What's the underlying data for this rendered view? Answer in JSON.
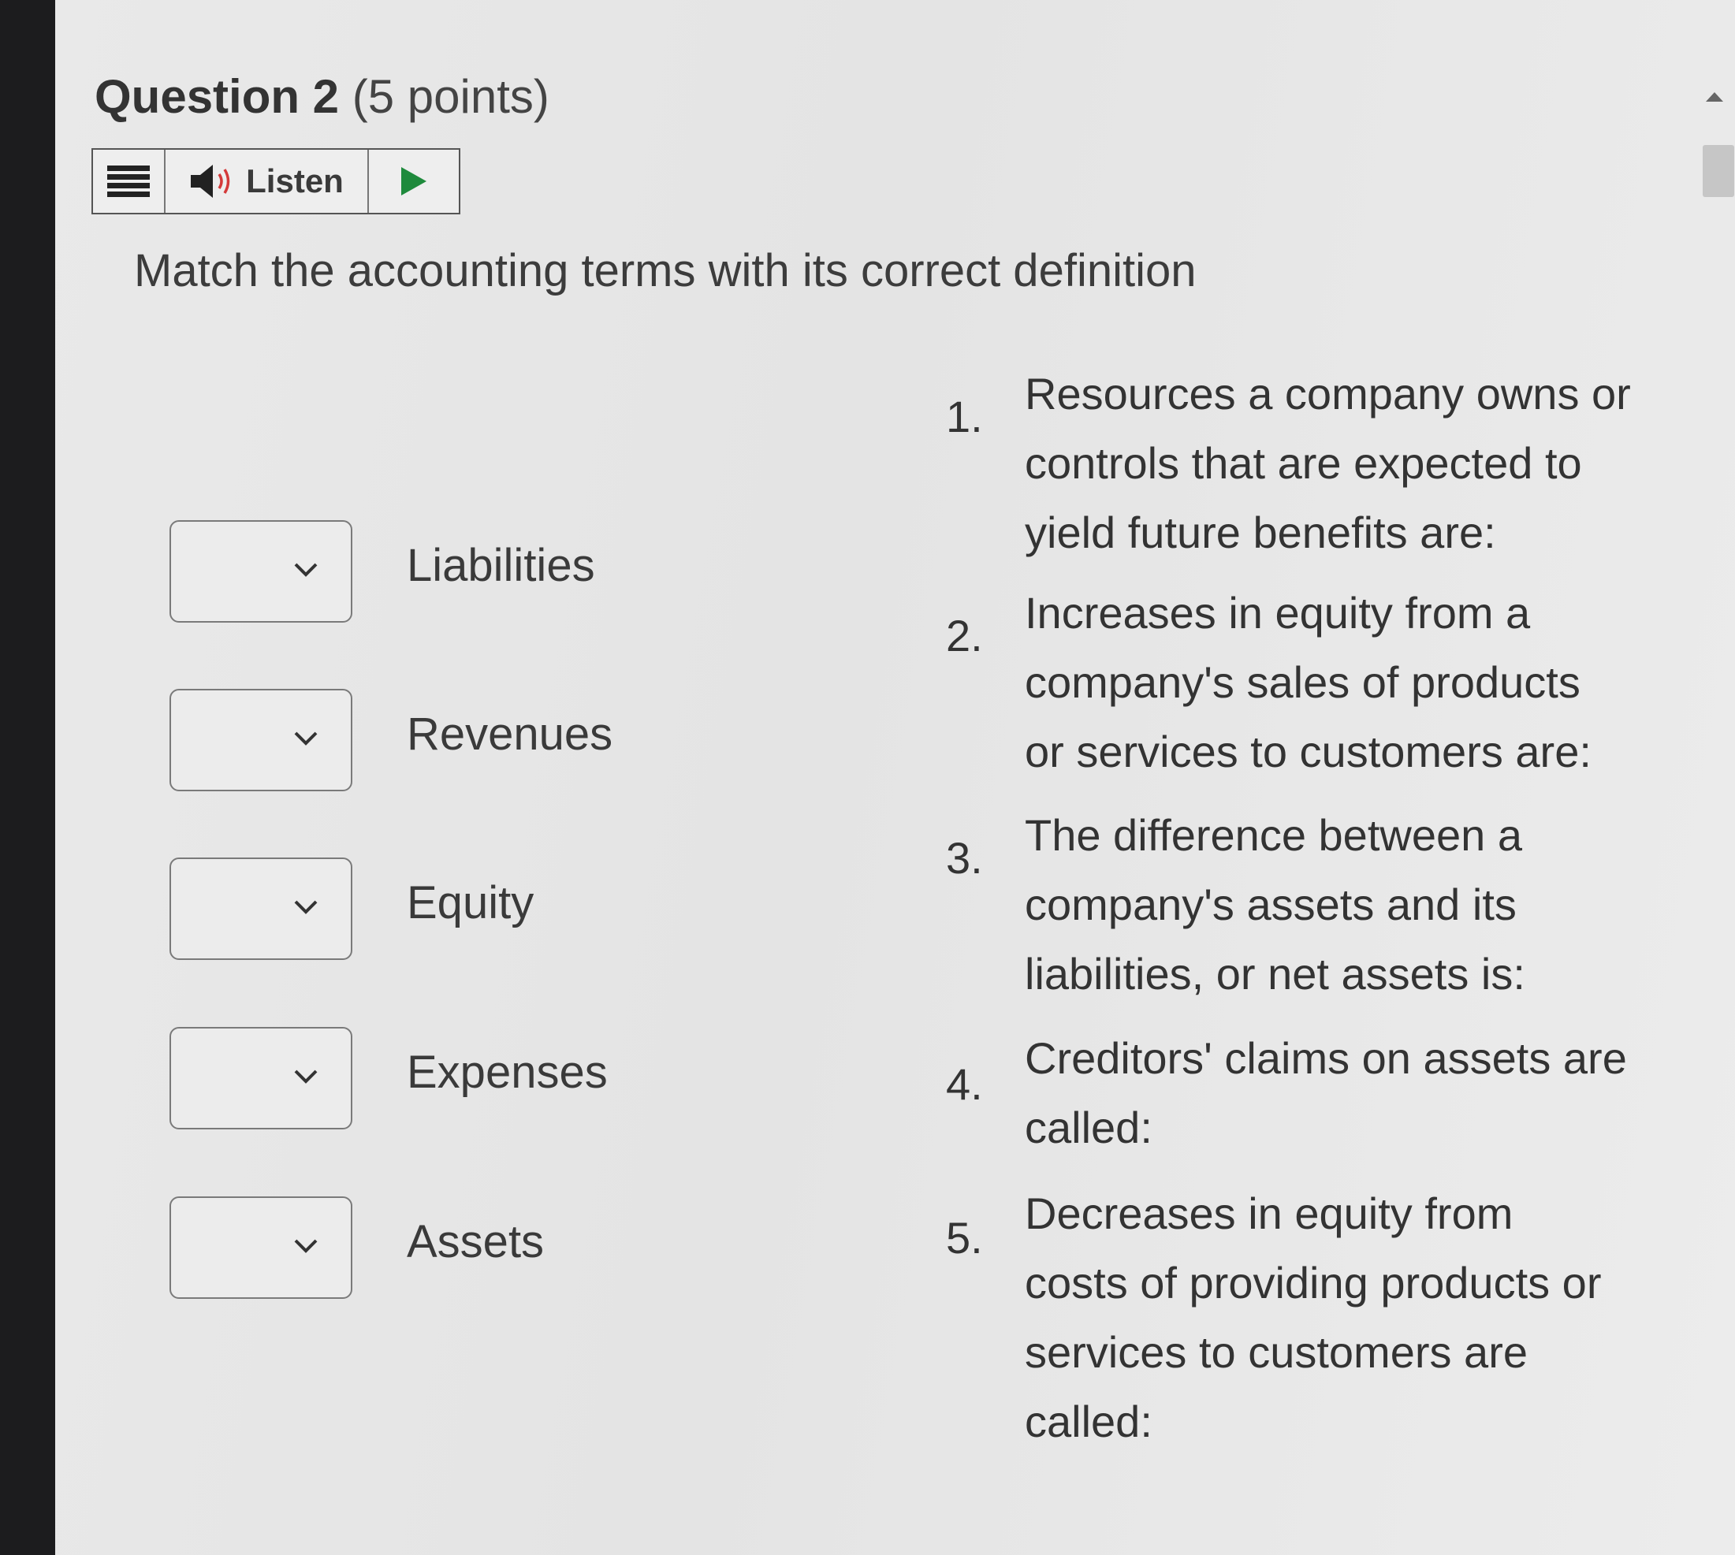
{
  "question": {
    "title": "Question 2",
    "points": "(5 points)"
  },
  "toolbar": {
    "listen_label": "Listen"
  },
  "instruction": "Match the accounting terms with its correct definition",
  "terms": [
    {
      "label": "Liabilities",
      "selected": ""
    },
    {
      "label": "Revenues",
      "selected": ""
    },
    {
      "label": "Equity",
      "selected": ""
    },
    {
      "label": "Expenses",
      "selected": ""
    },
    {
      "label": "Assets",
      "selected": ""
    }
  ],
  "definitions": [
    {
      "number": "1.",
      "lines": [
        "Resources a company owns or",
        "controls that are expected to",
        "yield future benefits are:"
      ]
    },
    {
      "number": "2.",
      "lines": [
        "Increases in equity from a",
        "company's sales of products",
        "or services to customers are:"
      ]
    },
    {
      "number": "3.",
      "lines": [
        "The difference between a",
        "company's assets and its",
        "liabilities, or net assets is:"
      ]
    },
    {
      "number": "4.",
      "lines": [
        "Creditors' claims on assets are",
        "called:"
      ]
    },
    {
      "number": "5.",
      "lines": [
        "Decreases in equity from",
        "costs of providing products or",
        "services to customers are",
        "called:"
      ]
    }
  ]
}
